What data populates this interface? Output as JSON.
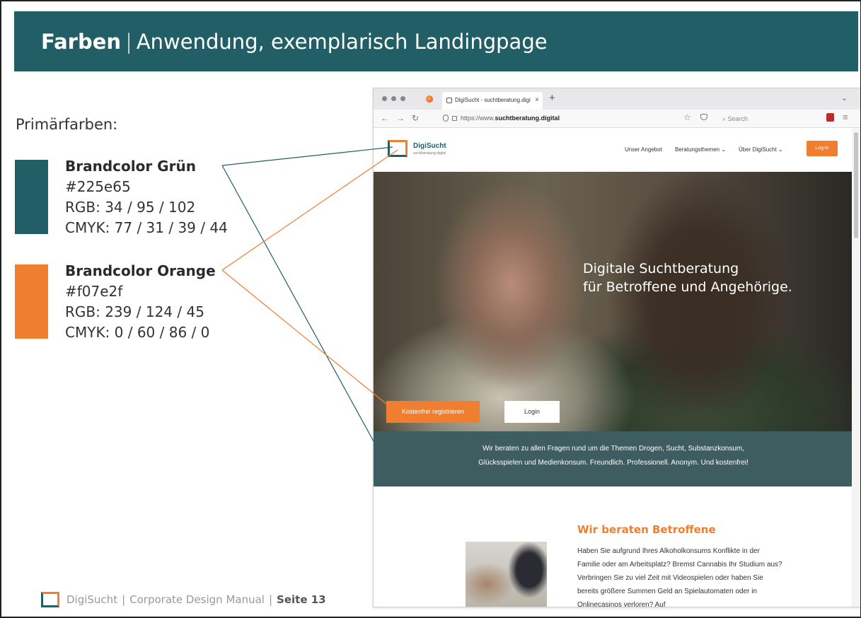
{
  "header": {
    "title_bold": "Farben",
    "separator": "|",
    "title_rest": "Anwendung, exemplarisch Landingpage"
  },
  "primary_label": "Primärfarben:",
  "colors": [
    {
      "name": "Brandcolor Grün",
      "hex": "#225e65",
      "rgb": "RGB: 34 / 95 / 102",
      "cmyk": "CMYK: 77 / 31 / 39 / 44"
    },
    {
      "name": "Brandcolor Orange",
      "hex": "#f07e2f",
      "rgb": "RGB: 239 / 124 / 45",
      "cmyk": "CMYK: 0 / 60 / 86 / 0"
    }
  ],
  "browser": {
    "tab_title": "DigiSucht - suchtberatung.digi",
    "tab_close": "×",
    "new_tab": "+",
    "tab_menu": "⌄",
    "url_prefix": "https://www.",
    "url_domain": "suchtberatung.digital",
    "search_placeholder": "Search"
  },
  "site": {
    "logo_text": "DigiSucht",
    "logo_sub": "suchtberatung.digital",
    "nav": [
      "Unser Angebot",
      "Beratungsthemen ⌄",
      "Über DigiSucht ⌄"
    ],
    "login": "Log-in",
    "hero_line1": "Digitale Suchtberatung",
    "hero_line2": "für Betroffene und Angehörige.",
    "btn_register": "Kostenfrei registrieren",
    "btn_login": "Login",
    "banner_line1": "Wir beraten zu allen Fragen rund um die Themen Drogen, Sucht, Substanzkonsum,",
    "banner_line2": "Glücksspielen und Medienkonsum. Freundlich. Professionell. Anonym. Und kostenfrei!",
    "section_title": "Wir beraten Betroffene",
    "section_text": "Haben Sie aufgrund Ihres Alkoholkonsums Konflikte in der Familie oder am Arbeitsplatz? Bremst Cannabis Ihr Studium aus? Verbringen Sie zu viel Zeit mit Videospielen oder haben Sie bereits größere Summen Geld an Spielautomaten oder in Onlinecasinos verloren? Auf"
  },
  "footer": {
    "brand": "DigiSucht",
    "separator": "|",
    "manual": "Corporate Design Manual",
    "page": "Seite 13"
  }
}
